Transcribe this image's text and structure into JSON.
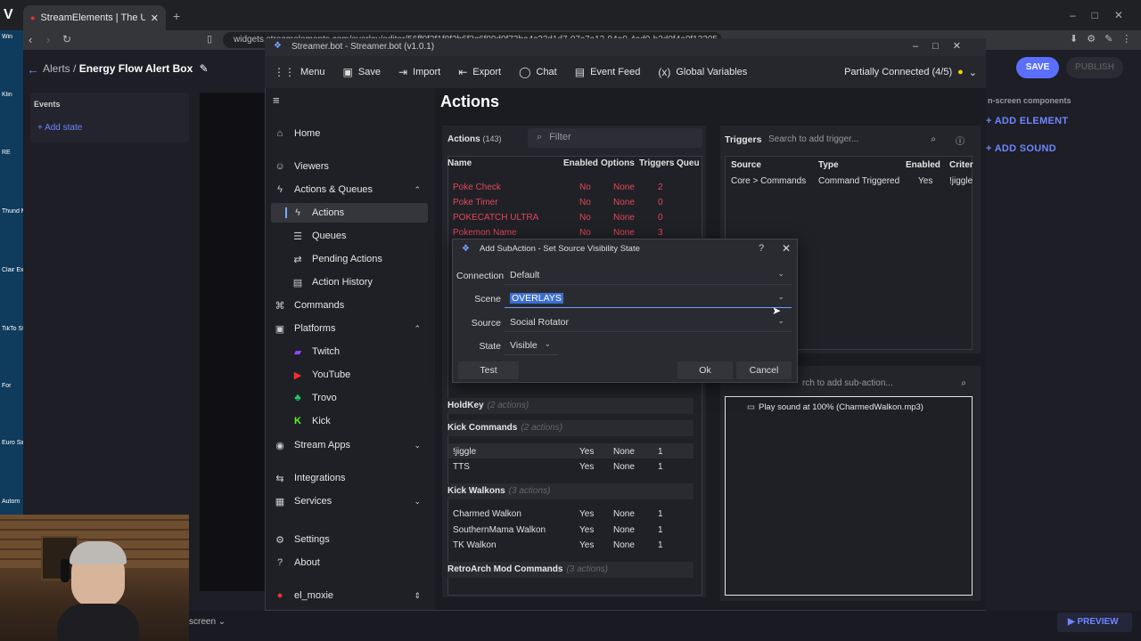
{
  "browser": {
    "tab_title": "StreamElements | The Ultimate",
    "url": "widgets.streamelements.com/overlay/editor/56ff0f2f1f8f2b6f3c6f09d0f73ba4c23d1d7-07c7a12-94a0-4ad0-b2d0f4a0f13205"
  },
  "desktop": {
    "labels": [
      "Win",
      "Klin",
      "RE",
      "Thund Mod",
      "Clair Exped",
      "TikTo Stu",
      "For",
      "Euro Simu",
      "Autom"
    ]
  },
  "streamelements": {
    "breadcrumb_root": "Alerts",
    "breadcrumb_sep": "/",
    "overlay_title": "Energy Flow Alert Box",
    "events_label": "Events",
    "add_state": "Add state",
    "save": "SAVE",
    "publish": "PUBLISH",
    "onscreen_components": "n-screen components",
    "add_element": "ADD ELEMENT",
    "add_sound": "ADD SOUND",
    "preview": "PREVIEW",
    "screen_label": "screen"
  },
  "streamerbot": {
    "title": "Streamer.bot - Streamer.bot (v1.0.1)",
    "toolbar": [
      "Menu",
      "Save",
      "Import",
      "Export",
      "Chat",
      "Event Feed",
      "Global Variables"
    ],
    "connection_status": "Partially Connected (4/5)",
    "nav": {
      "home": "Home",
      "viewers": "Viewers",
      "actions_queues": "Actions & Queues",
      "actions": "Actions",
      "queues": "Queues",
      "pending_actions": "Pending Actions",
      "action_history": "Action History",
      "commands": "Commands",
      "platforms": "Platforms",
      "twitch": "Twitch",
      "youtube": "YouTube",
      "trovo": "Trovo",
      "kick": "Kick",
      "stream_apps": "Stream Apps",
      "integrations": "Integrations",
      "services": "Services",
      "settings": "Settings",
      "about": "About",
      "user": "el_moxie"
    },
    "page_title": "Actions",
    "actions_label": "Actions",
    "actions_count": "(143)",
    "filter_placeholder": "Filter",
    "columns": [
      "Name",
      "Enabled",
      "Options",
      "Triggers",
      "Queu"
    ],
    "red_rows": [
      {
        "name": "Poke Check",
        "enabled": "No",
        "options": "None",
        "triggers": "2"
      },
      {
        "name": "Poke Timer",
        "enabled": "No",
        "options": "None",
        "triggers": "0"
      },
      {
        "name": "POKECATCH ULTRA",
        "enabled": "No",
        "options": "None",
        "triggers": "0"
      },
      {
        "name": "Pokemon Name",
        "enabled": "No",
        "options": "None",
        "triggers": "3"
      }
    ],
    "groups": {
      "holdkey": {
        "name": "HoldKey",
        "count": "(2 actions)"
      },
      "kick_commands": {
        "name": "Kick Commands",
        "count": "(2 actions)"
      },
      "kick_walkons": {
        "name": "Kick Walkons",
        "count": "(3 actions)"
      },
      "retroarch": {
        "name": "RetroArch Mod Commands",
        "count": "(3 actions)"
      }
    },
    "kick_commands_rows": [
      {
        "name": "!jiggle",
        "enabled": "Yes",
        "options": "None",
        "triggers": "1"
      },
      {
        "name": "TTS",
        "enabled": "Yes",
        "options": "None",
        "triggers": "1"
      }
    ],
    "kick_walkons_rows": [
      {
        "name": "Charmed Walkon",
        "enabled": "Yes",
        "options": "None",
        "triggers": "1"
      },
      {
        "name": "SouthernMama Walkon",
        "enabled": "Yes",
        "options": "None",
        "triggers": "1"
      },
      {
        "name": "TK Walkon",
        "enabled": "Yes",
        "options": "None",
        "triggers": "1"
      }
    ],
    "triggers": {
      "label": "Triggers",
      "search_placeholder": "Search to add trigger...",
      "columns": [
        "Source",
        "Type",
        "Enabled",
        "Criter"
      ],
      "row": {
        "source": "Core > Commands",
        "type": "Command Triggered",
        "enabled": "Yes",
        "criteria": "!jiggle"
      }
    },
    "subactions": {
      "search_placeholder": "rch to add sub-action...",
      "item": "Play sound at 100% (CharmedWalkon.mp3)"
    },
    "dialog": {
      "title": "Add SubAction - Set Source Visibility State",
      "help": "?",
      "connection_label": "Connection",
      "connection_value": "Default",
      "scene_label": "Scene",
      "scene_value": "OVERLAYS",
      "source_label": "Source",
      "source_value": "Social Rotator",
      "state_label": "State",
      "state_value": "Visible",
      "test": "Test",
      "ok": "Ok",
      "cancel": "Cancel"
    }
  }
}
